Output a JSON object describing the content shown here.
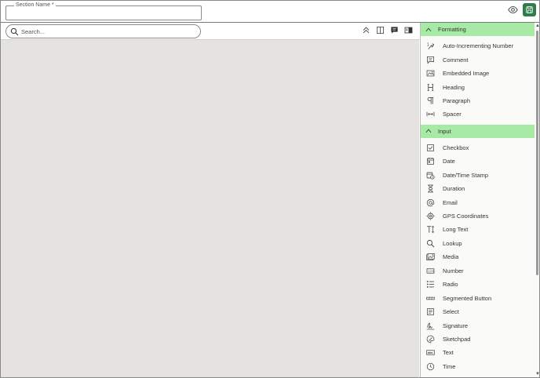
{
  "header": {
    "section_name_label": "Section Name *",
    "section_name_value": ""
  },
  "search": {
    "placeholder": "Search..."
  },
  "toolbar_icons": [
    "collapse-all-icon",
    "columns-icon",
    "comment-bubble-icon",
    "split-view-icon"
  ],
  "top_icons": [
    "eye-icon",
    "save-icon"
  ],
  "colors": {
    "category_header": "#a6eaa6",
    "save_button": "#2f7d4a",
    "canvas": "#e5e3df"
  },
  "palette": {
    "formatting": {
      "label": "Formatting",
      "items": [
        {
          "label": "Auto-Incrementing Number",
          "icon": "auto-number-icon"
        },
        {
          "label": "Comment",
          "icon": "comment-icon"
        },
        {
          "label": "Embedded Image",
          "icon": "image-icon"
        },
        {
          "label": "Heading",
          "icon": "heading-icon"
        },
        {
          "label": "Paragraph",
          "icon": "paragraph-icon"
        },
        {
          "label": "Spacer",
          "icon": "spacer-icon"
        }
      ]
    },
    "input": {
      "label": "Input",
      "items": [
        {
          "label": "Checkbox",
          "icon": "checkbox-icon"
        },
        {
          "label": "Date",
          "icon": "date-icon"
        },
        {
          "label": "Date/Time Stamp",
          "icon": "datetime-icon"
        },
        {
          "label": "Duration",
          "icon": "hourglass-icon"
        },
        {
          "label": "Email",
          "icon": "at-icon"
        },
        {
          "label": "GPS Coordinates",
          "icon": "gps-icon"
        },
        {
          "label": "Long Text",
          "icon": "long-text-icon"
        },
        {
          "label": "Lookup",
          "icon": "lookup-icon"
        },
        {
          "label": "Media",
          "icon": "media-icon"
        },
        {
          "label": "Number",
          "icon": "number-icon"
        },
        {
          "label": "Radio",
          "icon": "radio-list-icon"
        },
        {
          "label": "Segmented Button",
          "icon": "segmented-button-icon"
        },
        {
          "label": "Select",
          "icon": "select-icon"
        },
        {
          "label": "Signature",
          "icon": "signature-icon"
        },
        {
          "label": "Sketchpad",
          "icon": "sketchpad-icon"
        },
        {
          "label": "Text",
          "icon": "text-field-icon"
        },
        {
          "label": "Time",
          "icon": "clock-icon"
        }
      ]
    }
  }
}
